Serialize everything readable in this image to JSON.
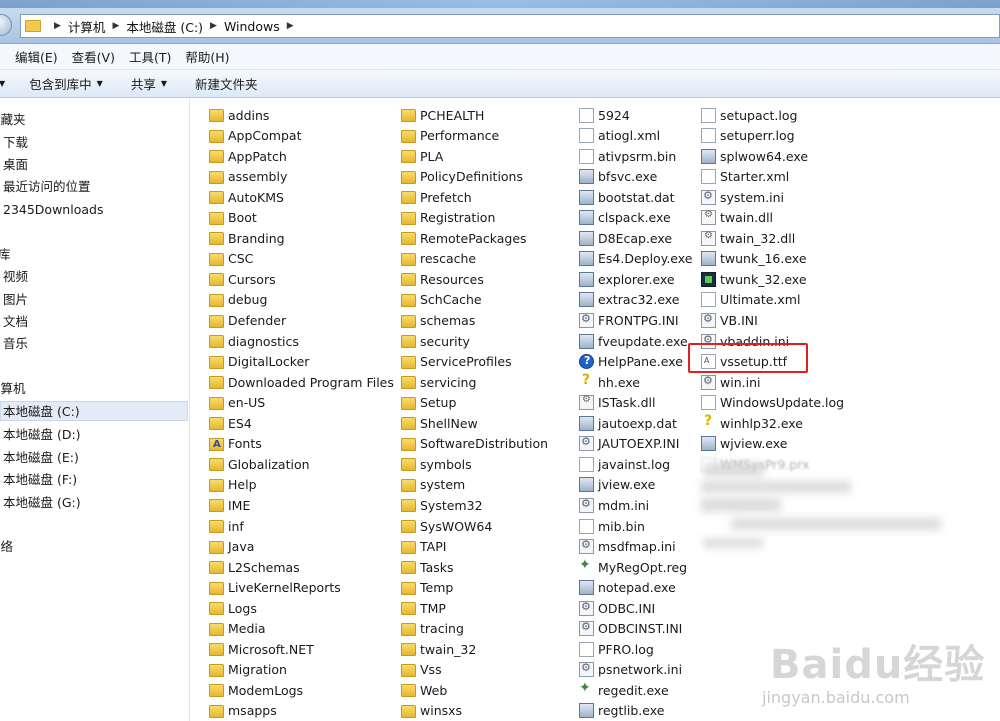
{
  "address_bar": {
    "breadcrumbs": [
      "计算机",
      "本地磁盘 (C:)",
      "Windows"
    ]
  },
  "menu": {
    "items": [
      "编辑(E)",
      "查看(V)",
      "工具(T)",
      "帮助(H)"
    ]
  },
  "toolbar": {
    "include_in_library": "包含到库中",
    "share": "共享",
    "new_folder": "新建文件夹"
  },
  "sidebar": {
    "favorites_header": "收藏夹",
    "favorites": [
      "下载",
      "桌面",
      "最近访问的位置",
      "2345Downloads"
    ],
    "libraries_header": "库",
    "libraries": [
      "视频",
      "图片",
      "文档",
      "音乐"
    ],
    "computer_header": "计算机",
    "drives": [
      "本地磁盘 (C:)",
      "本地磁盘 (D:)",
      "本地磁盘 (E:)",
      "本地磁盘 (F:)",
      "本地磁盘 (G:)"
    ],
    "network_header": "网络",
    "selected_drive": "本地磁盘 (C:)"
  },
  "files": {
    "col1": [
      "addins",
      "AppCompat",
      "AppPatch",
      "assembly",
      "AutoKMS",
      "Boot",
      "Branding",
      "CSC",
      "Cursors",
      "debug",
      "Defender",
      "diagnostics",
      "DigitalLocker",
      "Downloaded Program Files",
      "en-US",
      "ES4",
      "Fonts",
      "Globalization",
      "Help",
      "IME",
      "inf",
      "Java",
      "L2Schemas",
      "LiveKernelReports",
      "Logs",
      "Media",
      "Microsoft.NET",
      "Migration",
      "ModemLogs",
      "msapps"
    ],
    "col2": [
      "PCHEALTH",
      "Performance",
      "PLA",
      "PolicyDefinitions",
      "Prefetch",
      "Registration",
      "RemotePackages",
      "rescache",
      "Resources",
      "SchCache",
      "schemas",
      "security",
      "ServiceProfiles",
      "servicing",
      "Setup",
      "ShellNew",
      "SoftwareDistribution",
      "symbols",
      "system",
      "System32",
      "SysWOW64",
      "TAPI",
      "Tasks",
      "Temp",
      "TMP",
      "tracing",
      "twain_32",
      "Vss",
      "Web",
      "winsxs"
    ],
    "col3": [
      "5924",
      "atiogl.xml",
      "ativpsrm.bin",
      "bfsvc.exe",
      "bootstat.dat",
      "clspack.exe",
      "D8Ecap.exe",
      "Es4.Deploy.exe",
      "explorer.exe",
      "extrac32.exe",
      "FRONTPG.INI",
      "fveupdate.exe",
      "HelpPane.exe",
      "hh.exe",
      "ISTask.dll",
      "jautoexp.dat",
      "JAUTOEXP.INI",
      "javainst.log",
      "jview.exe",
      "mdm.ini",
      "mib.bin",
      "msdfmap.ini",
      "MyRegOpt.reg",
      "notepad.exe",
      "ODBC.INI",
      "ODBCINST.INI",
      "PFRO.log",
      "psnetwork.ini",
      "regedit.exe",
      "regtlib.exe"
    ],
    "col4": [
      "setupact.log",
      "setuperr.log",
      "splwow64.exe",
      "Starter.xml",
      "system.ini",
      "twain.dll",
      "twain_32.dll",
      "twunk_16.exe",
      "twunk_32.exe",
      "Ultimate.xml",
      "VB.INI",
      "vbaddin.ini",
      "vssetup.ttf",
      "win.ini",
      "WindowsUpdate.log",
      "winhlp32.exe",
      "wjview.exe",
      "WMSysPr9.prx"
    ],
    "col1_icons": [
      "folder",
      "folder",
      "folder",
      "folder",
      "folder",
      "folder",
      "folder",
      "folder",
      "folder",
      "folder",
      "folder",
      "folder",
      "folder",
      "folder",
      "folder",
      "folder",
      "fontsf",
      "folder",
      "folder",
      "folder",
      "folder",
      "folder",
      "folder",
      "folder",
      "folder",
      "folder",
      "folder",
      "folder",
      "folder",
      "folder"
    ],
    "col3_icons": [
      "doc",
      "doc",
      "doc",
      "exe",
      "exe",
      "exe",
      "exe",
      "exe",
      "exe",
      "exe",
      "ini",
      "exe",
      "help",
      "hlpq",
      "dll",
      "exe",
      "ini",
      "doc",
      "exe",
      "ini",
      "doc",
      "ini",
      "reg",
      "exe",
      "ini",
      "ini",
      "doc",
      "ini",
      "reg",
      "exe"
    ],
    "col4_icons": [
      "doc",
      "doc",
      "exe",
      "doc",
      "ini",
      "dll",
      "dll",
      "exe",
      "green",
      "doc",
      "ini",
      "ini",
      "ttf",
      "ini",
      "doc",
      "hlpq",
      "exe",
      "doc"
    ],
    "highlighted": "vssetup.ttf"
  },
  "watermark": {
    "logo": "Baidu经验",
    "url": "jingyan.baidu.com"
  }
}
